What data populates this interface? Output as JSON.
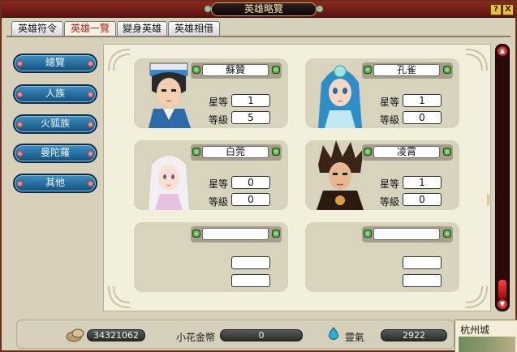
{
  "window": {
    "title": "英雄略覽"
  },
  "title_buttons": [
    {
      "label": "?"
    },
    {
      "label": "X"
    }
  ],
  "tabs": [
    {
      "label": "英雄符令",
      "active": false
    },
    {
      "label": "英雄一覽",
      "active": true
    },
    {
      "label": "變身英雄",
      "active": false
    },
    {
      "label": "英雄相借",
      "active": false
    }
  ],
  "nav": [
    {
      "label": "總覽"
    },
    {
      "label": "人族"
    },
    {
      "label": "火狐族"
    },
    {
      "label": "曼陀羅"
    },
    {
      "label": "其他"
    }
  ],
  "cards": [
    {
      "name": "蘇贊",
      "star_label": "星等",
      "star": "1",
      "level_label": "等級",
      "level": "5",
      "portrait": "portrait-icon-suzan"
    },
    {
      "name": "孔雀",
      "star_label": "星等",
      "star": "1",
      "level_label": "等級",
      "level": "0",
      "portrait": "portrait-icon-kongque"
    },
    {
      "name": "白莞",
      "star_label": "星等",
      "star": "0",
      "level_label": "等級",
      "level": "0",
      "portrait": "portrait-icon-baiwan"
    },
    {
      "name": "凌霄",
      "star_label": "星等",
      "star": "1",
      "level_label": "等級",
      "level": "0",
      "portrait": "portrait-icon-lingxiao"
    },
    {
      "name": "",
      "star_label": "",
      "star": "",
      "level_label": "",
      "level": ""
    },
    {
      "name": "",
      "star_label": "",
      "star": "",
      "level_label": "",
      "level": ""
    }
  ],
  "bottom": {
    "gold": "34321062",
    "flower_label": "小花金幣",
    "flower": "0",
    "spirit_label": "靈氣",
    "spirit": "2922"
  },
  "minimap": {
    "title": "杭州城"
  },
  "colors": {
    "frame": "#6b2a1a",
    "nav_button": "#1e6496",
    "panel": "#f2efdc",
    "card": "#d7d3bd"
  }
}
